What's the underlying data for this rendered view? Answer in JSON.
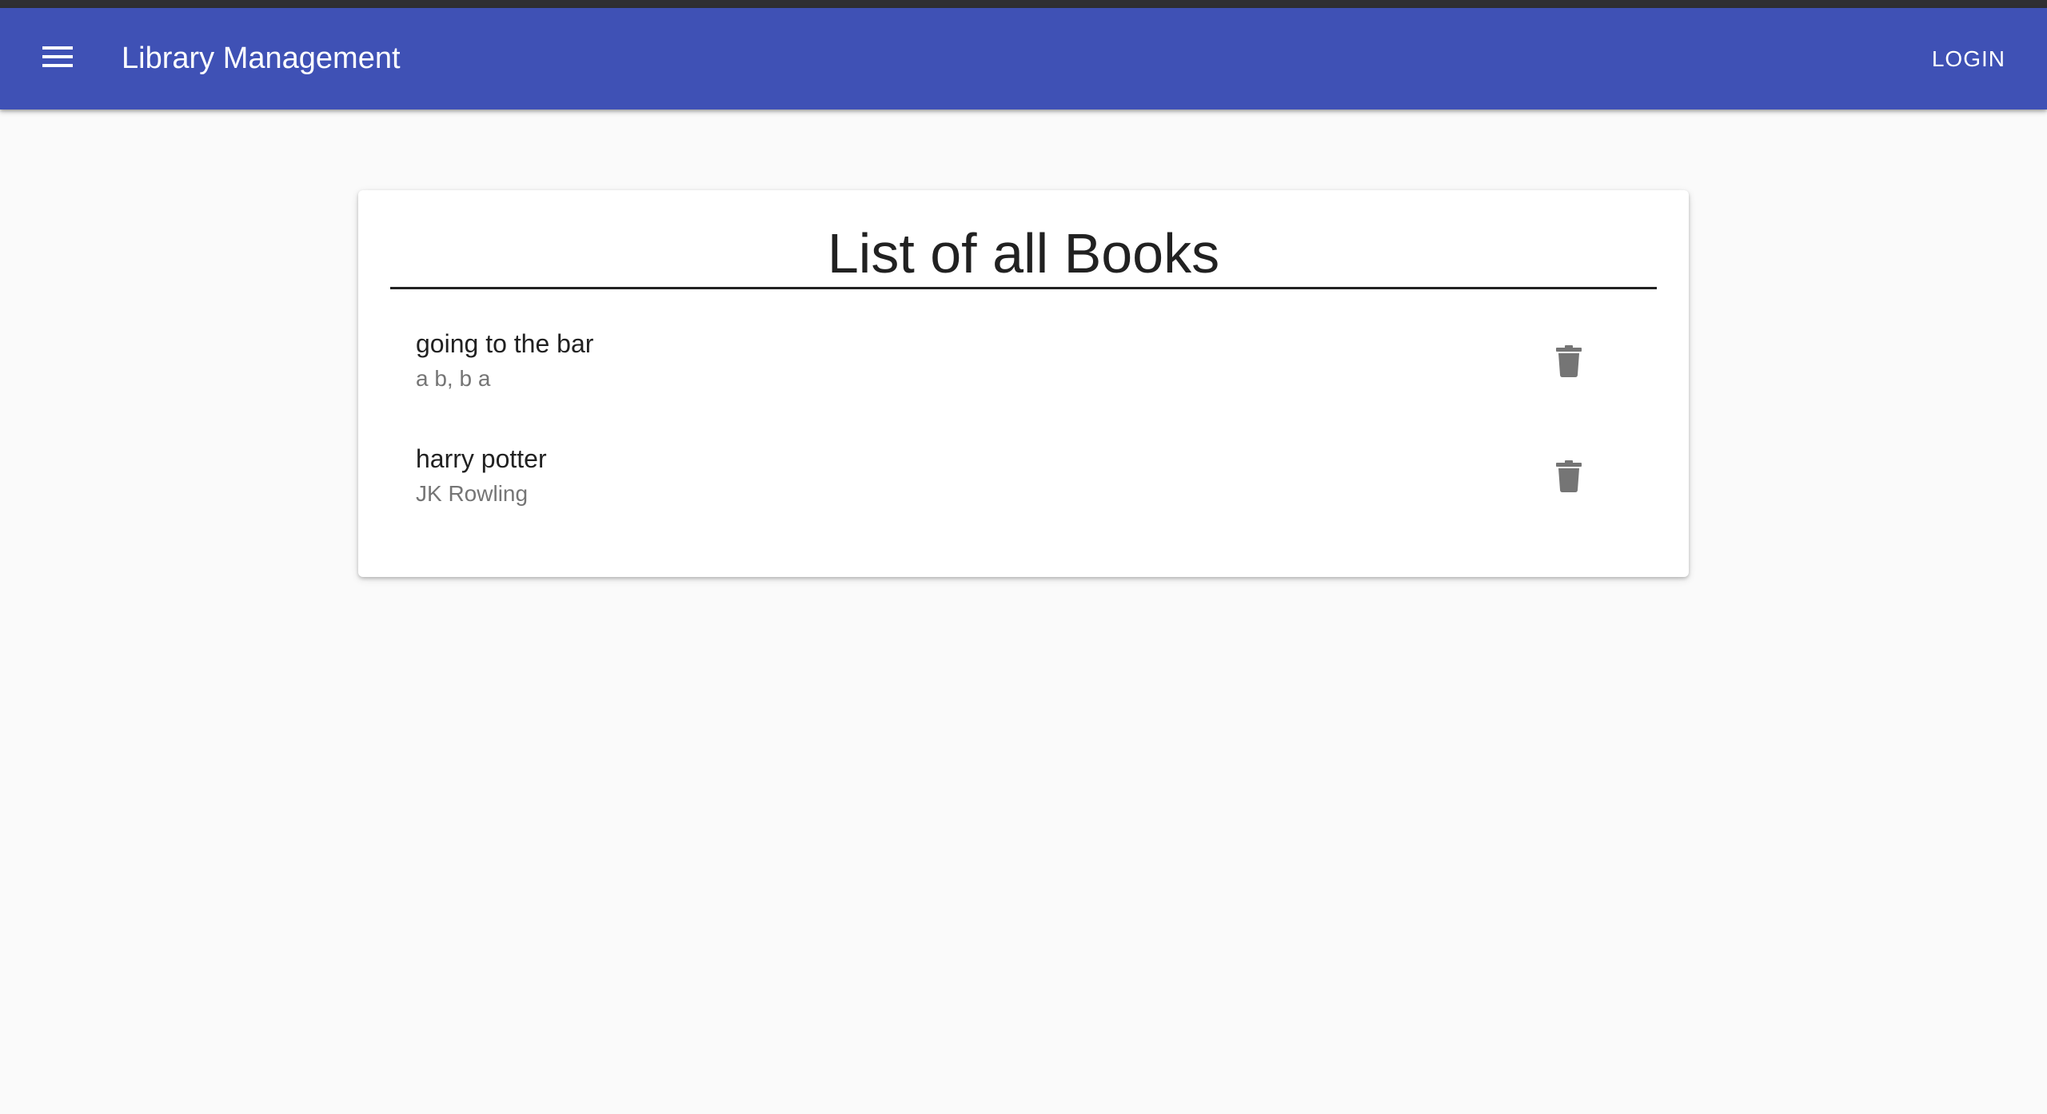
{
  "appbar": {
    "title": "Library Management",
    "menu_icon": "hamburger-menu-icon",
    "login_label": "LOGIN",
    "background": "#3f51b5"
  },
  "card": {
    "title": "List of all Books"
  },
  "books": [
    {
      "title": "going to the bar",
      "authors": "a b, b a",
      "action_icon": "trash-icon"
    },
    {
      "title": "harry potter",
      "authors": "JK Rowling",
      "action_icon": "trash-icon"
    }
  ]
}
